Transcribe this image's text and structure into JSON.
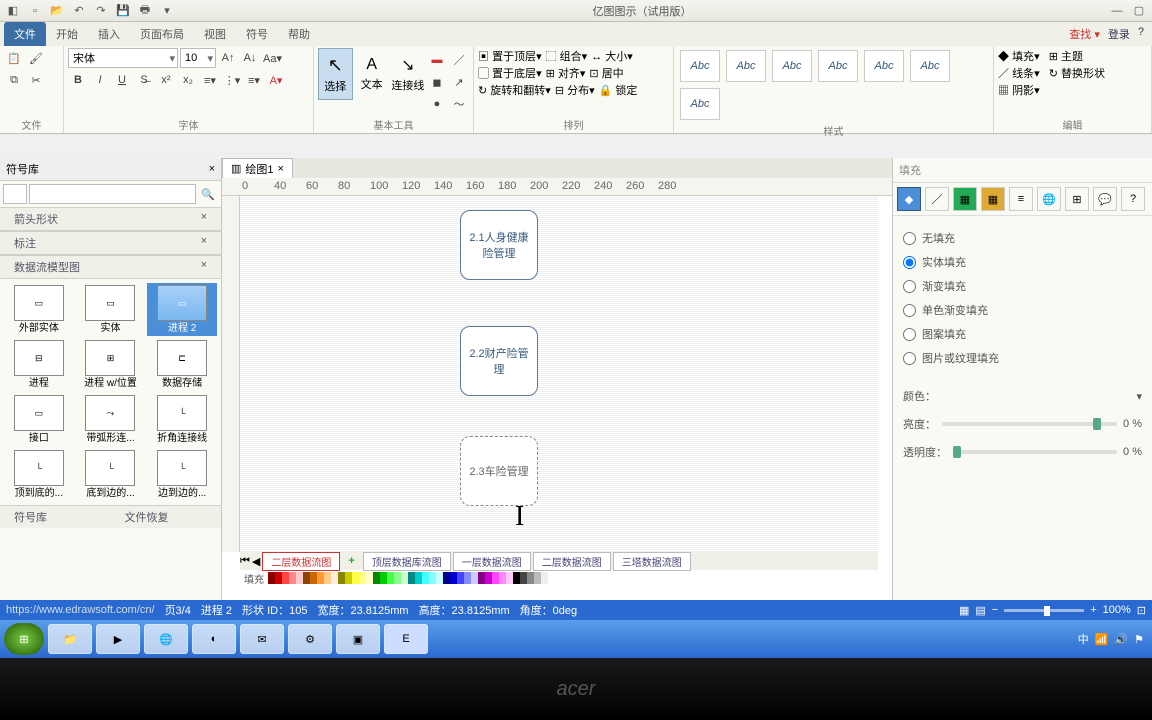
{
  "app": {
    "title": "亿图图示（试用版）"
  },
  "menubar": {
    "tabs": [
      "文件",
      "开始",
      "插入",
      "页面布局",
      "视图",
      "符号",
      "帮助"
    ],
    "right": {
      "find": "查找 ▾",
      "login": "登录"
    }
  },
  "ribbon": {
    "font": {
      "family": "宋体",
      "size": "10"
    },
    "groups": {
      "file": "文件",
      "font": "字体",
      "tool": "基本工具",
      "arrange": "排列",
      "style": "样式",
      "edit": "编辑"
    },
    "tools": {
      "select": "选择",
      "text": "文本",
      "connector": "连接线"
    },
    "arrange": {
      "top": "置于顶层",
      "bottom": "置于底层",
      "rotate": "旋转和翻转",
      "group": "组合",
      "align": "对齐",
      "distribute": "分布",
      "size": "大小",
      "center": "居中",
      "lock": "锁定"
    },
    "stylebox": "Abc",
    "edit": {
      "fill": "填充",
      "line": "线条",
      "shadow": "阴影",
      "theme": "主题",
      "replace": "替换形状"
    }
  },
  "leftpane": {
    "title": "符号库",
    "cats": [
      "箭头形状",
      "标注",
      "数据流模型图"
    ],
    "shapes": [
      "外部实体",
      "实体",
      "进程 2",
      "进程",
      "进程 w/位置",
      "数据存储",
      "接口",
      "带弧形连...",
      "折角连接线",
      "顶到底的...",
      "底到边的...",
      "边到边的..."
    ],
    "bottom": [
      "符号库",
      "文件恢复"
    ]
  },
  "doc": {
    "tab": "绘图1"
  },
  "nodes": {
    "n1": "2.1人身健康\n险管理",
    "n2": "2.2财产险管\n理",
    "n3": "2.3车险管理"
  },
  "sheets": [
    "二层数据流图",
    "顶层数据库流图",
    "一层数据流图",
    "二层数据流图",
    "三塔数据流图"
  ],
  "colorbarLabel": "填充",
  "rightpane": {
    "title": "填充",
    "radios": [
      "无填充",
      "实体填充",
      "渐变填充",
      "单色渐变填充",
      "图案填充",
      "图片或纹理填充"
    ],
    "selectedRadio": 1,
    "color": "颜色：",
    "brightness": "亮度：",
    "opacity": "透明度：",
    "pct": "0 %"
  },
  "statusbar": {
    "url": "https://www.edrawsoft.com/cn/",
    "page": "页3/4",
    "shape": "进程 2",
    "id": "形状 ID：105",
    "w": "宽度：23.8125mm",
    "h": "高度：23.8125mm",
    "angle": "角度：0deg",
    "zoom": "100%"
  },
  "ruler": [
    0,
    40,
    60,
    80,
    100,
    120,
    140,
    160,
    180,
    200,
    220,
    240,
    260,
    280
  ],
  "bezel": "acer"
}
